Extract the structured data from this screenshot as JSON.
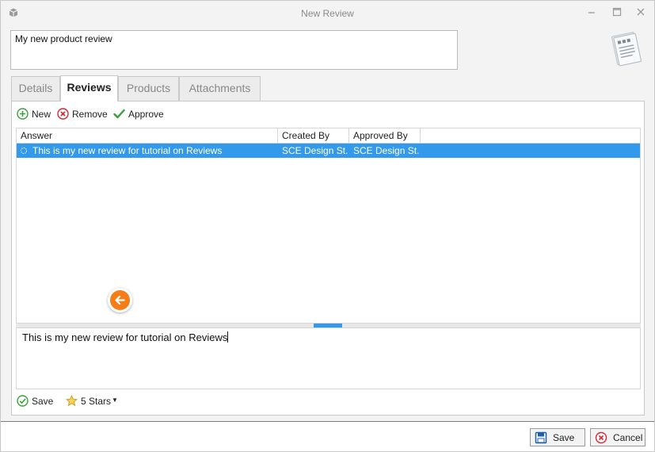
{
  "window": {
    "title": "New Review",
    "app_icon": "package-icon"
  },
  "header": {
    "review_name": "My new product review",
    "doc_icon": "document-icon"
  },
  "tabs": [
    {
      "label": "Details",
      "active": false
    },
    {
      "label": "Reviews",
      "active": true
    },
    {
      "label": "Products",
      "active": false
    },
    {
      "label": "Attachments",
      "active": false
    }
  ],
  "toolbar": {
    "new_label": "New",
    "remove_label": "Remove",
    "approve_label": "Approve"
  },
  "grid": {
    "columns": [
      "Answer",
      "Created By",
      "Approved By"
    ],
    "rows": [
      {
        "answer": "This is my new review for tutorial on Reviews",
        "created_by": "SCE Design St...",
        "approved_by": "SCE Design St..."
      }
    ]
  },
  "editor": {
    "text": "This is my new review for tutorial on Reviews"
  },
  "bottom_bar": {
    "save_label": "Save",
    "rating_label": "5 Stars"
  },
  "footer": {
    "save_label": "Save",
    "cancel_label": "Cancel"
  },
  "colors": {
    "selection": "#3399ea",
    "accent_orange": "#f57c17",
    "ok_green": "#3aa03a",
    "remove_red": "#d9262f"
  }
}
